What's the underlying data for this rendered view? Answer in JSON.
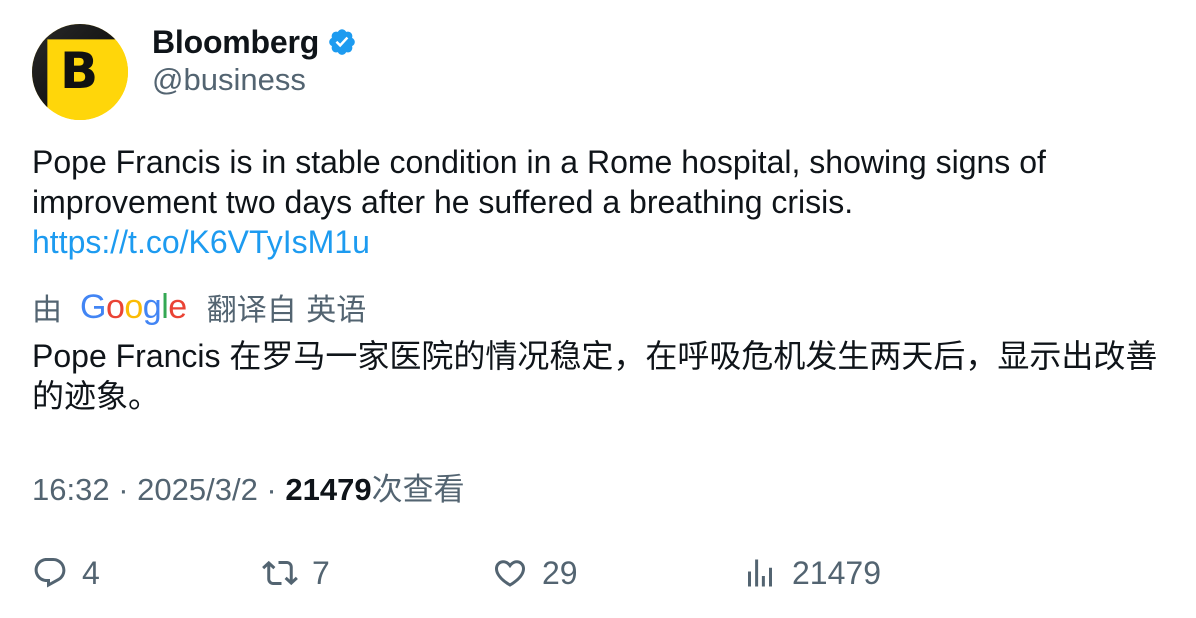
{
  "author": {
    "display_name": "Bloomberg",
    "handle": "@business",
    "avatar_letter": "B",
    "verified": true,
    "verified_color": "#1d9bf0"
  },
  "tweet": {
    "text_line1": "Pope Francis is in stable condition in a Rome hospital, showing signs of",
    "text_line2": "improvement two days after he suffered a breathing crisis.",
    "link": "https://t.co/K6VTyIsM1u"
  },
  "translation": {
    "prefix": "由",
    "provider": "Google",
    "suffix": "翻译自 英语",
    "text_line1": "Pope Francis 在罗马一家医院的情况稳定，在呼吸危机发生两天后，显示出改善",
    "text_line2": "的迹象。"
  },
  "meta": {
    "time": "16:32",
    "separator": " · ",
    "date": "2025/3/2",
    "views_count": "21479",
    "views_label": "次查看"
  },
  "actions": {
    "replies": "4",
    "retweets": "7",
    "likes": "29",
    "views": "21479"
  },
  "colors": {
    "text": "#0f1419",
    "secondary": "#536471",
    "link": "#1d9bf0",
    "avatar_bg": "#ffd60a"
  }
}
